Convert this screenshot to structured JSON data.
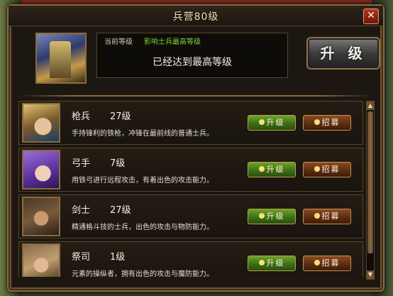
{
  "window": {
    "title": "兵营80级",
    "close_label": "✕"
  },
  "current_level": {
    "label": "当前等级",
    "effect": "影响士兵最高等级",
    "status": "已经达到最高等级"
  },
  "main_upgrade_button": "升 级",
  "units": [
    {
      "name": "枪兵",
      "level": "27级",
      "description": "手持锋利的铁枪，冲锋在最前线的普通士兵。",
      "upgrade_label": "升级",
      "recruit_label": "招募"
    },
    {
      "name": "弓手",
      "level": "7级",
      "description": "用铁弓进行远程攻击，有着出色的攻击能力。",
      "upgrade_label": "升级",
      "recruit_label": "招募"
    },
    {
      "name": "剑士",
      "level": "27级",
      "description": "精通格斗技的士兵，出色的攻击与物防能力。",
      "upgrade_label": "升级",
      "recruit_label": "招募"
    },
    {
      "name": "祭司",
      "level": "1级",
      "description": "元素的操纵者，拥有出色的攻击与魔防能力。",
      "upgrade_label": "升级",
      "recruit_label": "招募"
    }
  ],
  "scrollbar": {
    "up": "▲",
    "down": "▼"
  },
  "colors": {
    "accent_green": "#7ed23a",
    "frame_gold": "#8a6a3e"
  }
}
